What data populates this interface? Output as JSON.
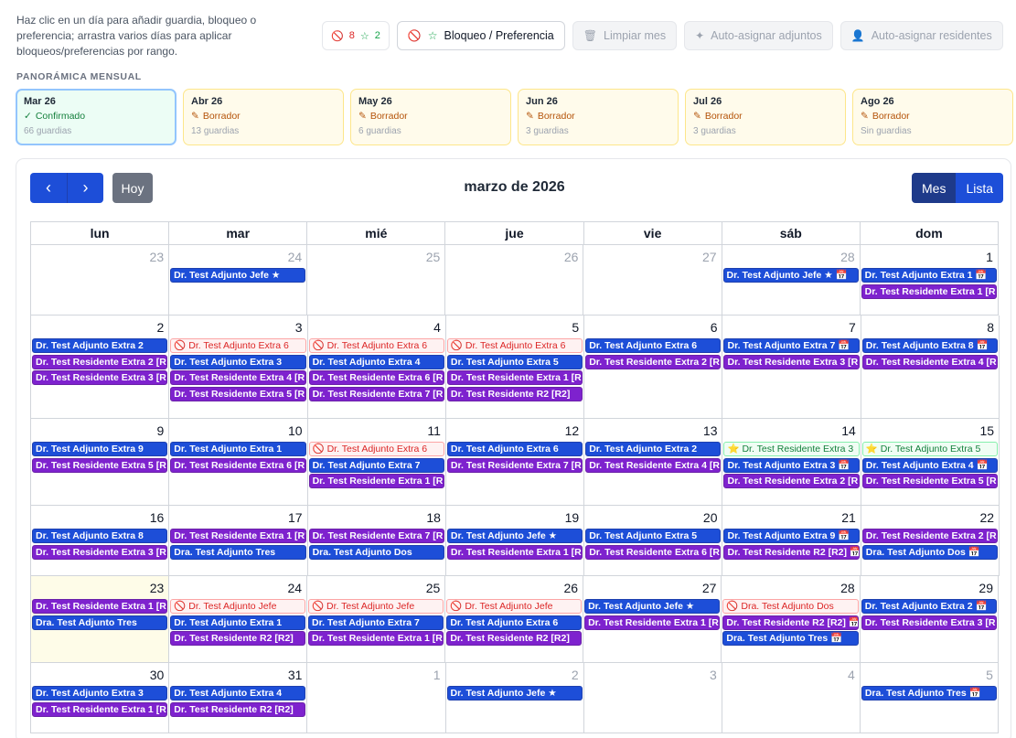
{
  "help_text": "Haz clic en un día para añadir guardia, bloqueo o preferencia; arrastra varios días para aplicar bloqueos/preferencias por rango.",
  "toolbar": {
    "block_count": "8",
    "pref_count": "2",
    "block_pref_label": "Bloqueo / Preferencia",
    "clear_month_label": "Limpiar mes",
    "auto_adjuntos_label": "Auto-asignar adjuntos",
    "auto_residentes_label": "Auto-asignar residentes"
  },
  "overview": {
    "title": "PANORÁMICA MENSUAL",
    "months": [
      {
        "name": "Mar 26",
        "status": "Confirmado",
        "count": "66 guardias",
        "state": "confirmed"
      },
      {
        "name": "Abr 26",
        "status": "Borrador",
        "count": "13 guardias",
        "state": "draft"
      },
      {
        "name": "May 26",
        "status": "Borrador",
        "count": "6 guardias",
        "state": "draft"
      },
      {
        "name": "Jun 26",
        "status": "Borrador",
        "count": "3 guardias",
        "state": "draft"
      },
      {
        "name": "Jul 26",
        "status": "Borrador",
        "count": "3 guardias",
        "state": "draft"
      },
      {
        "name": "Ago 26",
        "status": "Borrador",
        "count": "Sin guardias",
        "state": "draft"
      }
    ]
  },
  "calendar": {
    "title": "marzo de 2026",
    "today_label": "Hoy",
    "prev_icon": "‹",
    "next_icon": "›",
    "view_month_label": "Mes",
    "view_list_label": "Lista",
    "weekdays": [
      "lun",
      "mar",
      "mié",
      "jue",
      "vie",
      "sáb",
      "dom"
    ],
    "weeks": [
      {
        "height": 77,
        "days": [
          {
            "num": "23",
            "other": true,
            "events": []
          },
          {
            "num": "24",
            "other": true,
            "events": [
              {
                "text": "Dr. Test Adjunto Jefe ★",
                "kind": "blue"
              }
            ]
          },
          {
            "num": "25",
            "other": true,
            "events": []
          },
          {
            "num": "26",
            "other": true,
            "events": []
          },
          {
            "num": "27",
            "other": true,
            "events": []
          },
          {
            "num": "28",
            "other": true,
            "events": [
              {
                "text": "Dr. Test Adjunto Jefe ★ 📅",
                "kind": "blue"
              }
            ]
          },
          {
            "num": "1",
            "events": [
              {
                "text": "Dr. Test Adjunto Extra 1 📅",
                "kind": "blue"
              },
              {
                "text": "Dr. Test Residente Extra 1 [R",
                "kind": "purple"
              }
            ]
          }
        ]
      },
      {
        "height": 113,
        "days": [
          {
            "num": "2",
            "events": [
              {
                "text": "Dr. Test Adjunto Extra 2",
                "kind": "blue"
              },
              {
                "text": "Dr. Test Residente Extra 2 [R2",
                "kind": "purple"
              },
              {
                "text": "Dr. Test Residente Extra 3 [R2",
                "kind": "purple"
              }
            ]
          },
          {
            "num": "3",
            "events": [
              {
                "text": "🚫 Dr. Test Adjunto Extra 6",
                "kind": "block"
              },
              {
                "text": "Dr. Test Adjunto Extra 3",
                "kind": "blue"
              },
              {
                "text": "Dr. Test Residente Extra 4 [R",
                "kind": "purple"
              },
              {
                "text": "Dr. Test Residente Extra 5 [R",
                "kind": "purple"
              }
            ]
          },
          {
            "num": "4",
            "events": [
              {
                "text": "🚫 Dr. Test Adjunto Extra 6",
                "kind": "block"
              },
              {
                "text": "Dr. Test Adjunto Extra 4",
                "kind": "blue"
              },
              {
                "text": "Dr. Test Residente Extra 6 [R",
                "kind": "purple"
              },
              {
                "text": "Dr. Test Residente Extra 7 [R",
                "kind": "purple"
              }
            ]
          },
          {
            "num": "5",
            "events": [
              {
                "text": "🚫 Dr. Test Adjunto Extra 6",
                "kind": "block"
              },
              {
                "text": "Dr. Test Adjunto Extra 5",
                "kind": "blue"
              },
              {
                "text": "Dr. Test Residente Extra 1 [R'",
                "kind": "purple"
              },
              {
                "text": "Dr. Test Residente R2 [R2]",
                "kind": "purple"
              }
            ]
          },
          {
            "num": "6",
            "events": [
              {
                "text": "Dr. Test Adjunto Extra 6",
                "kind": "blue"
              },
              {
                "text": "Dr. Test Residente Extra 2 [R",
                "kind": "purple"
              }
            ]
          },
          {
            "num": "7",
            "events": [
              {
                "text": "Dr. Test Adjunto Extra 7 📅",
                "kind": "blue"
              },
              {
                "text": "Dr. Test Residente Extra 3 [R",
                "kind": "purple"
              }
            ]
          },
          {
            "num": "8",
            "events": [
              {
                "text": "Dr. Test Adjunto Extra 8 📅",
                "kind": "blue"
              },
              {
                "text": "Dr. Test Residente Extra 4 [R",
                "kind": "purple"
              }
            ]
          }
        ]
      },
      {
        "height": 95,
        "days": [
          {
            "num": "9",
            "events": [
              {
                "text": "Dr. Test Adjunto Extra 9",
                "kind": "blue"
              },
              {
                "text": "Dr. Test Residente Extra 5 [R'",
                "kind": "purple"
              }
            ]
          },
          {
            "num": "10",
            "events": [
              {
                "text": "Dr. Test Adjunto Extra 1",
                "kind": "blue"
              },
              {
                "text": "Dr. Test Residente Extra 6 [R",
                "kind": "purple"
              }
            ]
          },
          {
            "num": "11",
            "events": [
              {
                "text": "🚫 Dr. Test Adjunto Extra 6",
                "kind": "block"
              },
              {
                "text": "Dr. Test Adjunto Extra 7",
                "kind": "blue"
              },
              {
                "text": "Dr. Test Residente Extra 1 [R'",
                "kind": "purple"
              }
            ]
          },
          {
            "num": "12",
            "events": [
              {
                "text": "Dr. Test Adjunto Extra 6",
                "kind": "blue"
              },
              {
                "text": "Dr. Test Residente Extra 7 [R",
                "kind": "purple"
              }
            ]
          },
          {
            "num": "13",
            "events": [
              {
                "text": "Dr. Test Adjunto Extra 2",
                "kind": "blue"
              },
              {
                "text": "Dr. Test Residente Extra 4 [R",
                "kind": "purple"
              }
            ]
          },
          {
            "num": "14",
            "events": [
              {
                "text": "⭐ Dr. Test Residente Extra 3",
                "kind": "pref"
              },
              {
                "text": "Dr. Test Adjunto Extra 3 📅",
                "kind": "blue"
              },
              {
                "text": "Dr. Test Residente Extra 2 [R",
                "kind": "purple"
              }
            ]
          },
          {
            "num": "15",
            "events": [
              {
                "text": "⭐ Dr. Test Adjunto Extra 5",
                "kind": "pref"
              },
              {
                "text": "Dr. Test Adjunto Extra 4 📅",
                "kind": "blue"
              },
              {
                "text": "Dr. Test Residente Extra 5 [R",
                "kind": "purple"
              }
            ]
          }
        ]
      },
      {
        "height": 77,
        "days": [
          {
            "num": "16",
            "events": [
              {
                "text": "Dr. Test Adjunto Extra 8",
                "kind": "blue"
              },
              {
                "text": "Dr. Test Residente Extra 3 [R2",
                "kind": "purple"
              }
            ]
          },
          {
            "num": "17",
            "events": [
              {
                "text": "Dr. Test Residente Extra 1 [R'",
                "kind": "purple"
              },
              {
                "text": "Dra. Test Adjunto Tres",
                "kind": "blue"
              }
            ]
          },
          {
            "num": "18",
            "events": [
              {
                "text": "Dr. Test Residente Extra 7 [R",
                "kind": "purple"
              },
              {
                "text": "Dra. Test Adjunto Dos",
                "kind": "blue"
              }
            ]
          },
          {
            "num": "19",
            "events": [
              {
                "text": "Dr. Test Adjunto Jefe ★",
                "kind": "blue"
              },
              {
                "text": "Dr. Test Residente Extra 1 [R'",
                "kind": "purple"
              }
            ]
          },
          {
            "num": "20",
            "events": [
              {
                "text": "Dr. Test Adjunto Extra 5",
                "kind": "blue"
              },
              {
                "text": "Dr. Test Residente Extra 6 [R",
                "kind": "purple"
              }
            ]
          },
          {
            "num": "21",
            "events": [
              {
                "text": "Dr. Test Adjunto Extra 9 📅",
                "kind": "blue"
              },
              {
                "text": "Dr. Test Residente R2 [R2] 📅",
                "kind": "purple"
              }
            ]
          },
          {
            "num": "22",
            "events": [
              {
                "text": "Dr. Test Residente Extra 2 [R",
                "kind": "purple"
              },
              {
                "text": "Dra. Test Adjunto Dos 📅",
                "kind": "blue"
              }
            ]
          }
        ]
      },
      {
        "height": 95,
        "days": [
          {
            "num": "23",
            "today": true,
            "events": [
              {
                "text": "Dr. Test Residente Extra 1 [R1",
                "kind": "purple"
              },
              {
                "text": "Dra. Test Adjunto Tres",
                "kind": "blue"
              }
            ]
          },
          {
            "num": "24",
            "events": [
              {
                "text": "🚫 Dr. Test Adjunto Jefe",
                "kind": "block"
              },
              {
                "text": "Dr. Test Adjunto Extra 1",
                "kind": "blue"
              },
              {
                "text": "Dr. Test Residente R2 [R2]",
                "kind": "purple"
              }
            ]
          },
          {
            "num": "25",
            "events": [
              {
                "text": "🚫 Dr. Test Adjunto Jefe",
                "kind": "block"
              },
              {
                "text": "Dr. Test Adjunto Extra 7",
                "kind": "blue"
              },
              {
                "text": "Dr. Test Residente Extra 1 [R'",
                "kind": "purple"
              }
            ]
          },
          {
            "num": "26",
            "events": [
              {
                "text": "🚫 Dr. Test Adjunto Jefe",
                "kind": "block"
              },
              {
                "text": "Dr. Test Adjunto Extra 6",
                "kind": "blue"
              },
              {
                "text": "Dr. Test Residente R2 [R2]",
                "kind": "purple"
              }
            ]
          },
          {
            "num": "27",
            "events": [
              {
                "text": "Dr. Test Adjunto Jefe ★",
                "kind": "blue"
              },
              {
                "text": "Dr. Test Residente Extra 1 [R'",
                "kind": "purple"
              }
            ]
          },
          {
            "num": "28",
            "events": [
              {
                "text": "🚫 Dra. Test Adjunto Dos",
                "kind": "block"
              },
              {
                "text": "Dr. Test Residente R2 [R2] 📅",
                "kind": "purple"
              },
              {
                "text": "Dra. Test Adjunto Tres 📅",
                "kind": "blue"
              }
            ]
          },
          {
            "num": "29",
            "events": [
              {
                "text": "Dr. Test Adjunto Extra 2 📅",
                "kind": "blue"
              },
              {
                "text": "Dr. Test Residente Extra 3 [R",
                "kind": "purple"
              }
            ]
          }
        ]
      },
      {
        "height": 77,
        "days": [
          {
            "num": "30",
            "events": [
              {
                "text": "Dr. Test Adjunto Extra 3",
                "kind": "blue"
              },
              {
                "text": "Dr. Test Residente Extra 1 [R1",
                "kind": "purple"
              }
            ]
          },
          {
            "num": "31",
            "events": [
              {
                "text": "Dr. Test Adjunto Extra 4",
                "kind": "blue"
              },
              {
                "text": "Dr. Test Residente R2 [R2]",
                "kind": "purple"
              }
            ]
          },
          {
            "num": "1",
            "other": true,
            "events": []
          },
          {
            "num": "2",
            "other": true,
            "events": [
              {
                "text": "Dr. Test Adjunto Jefe ★",
                "kind": "blue"
              }
            ]
          },
          {
            "num": "3",
            "other": true,
            "events": []
          },
          {
            "num": "4",
            "other": true,
            "events": []
          },
          {
            "num": "5",
            "other": true,
            "events": [
              {
                "text": "Dra. Test Adjunto Tres 📅",
                "kind": "blue"
              }
            ]
          }
        ]
      }
    ]
  }
}
